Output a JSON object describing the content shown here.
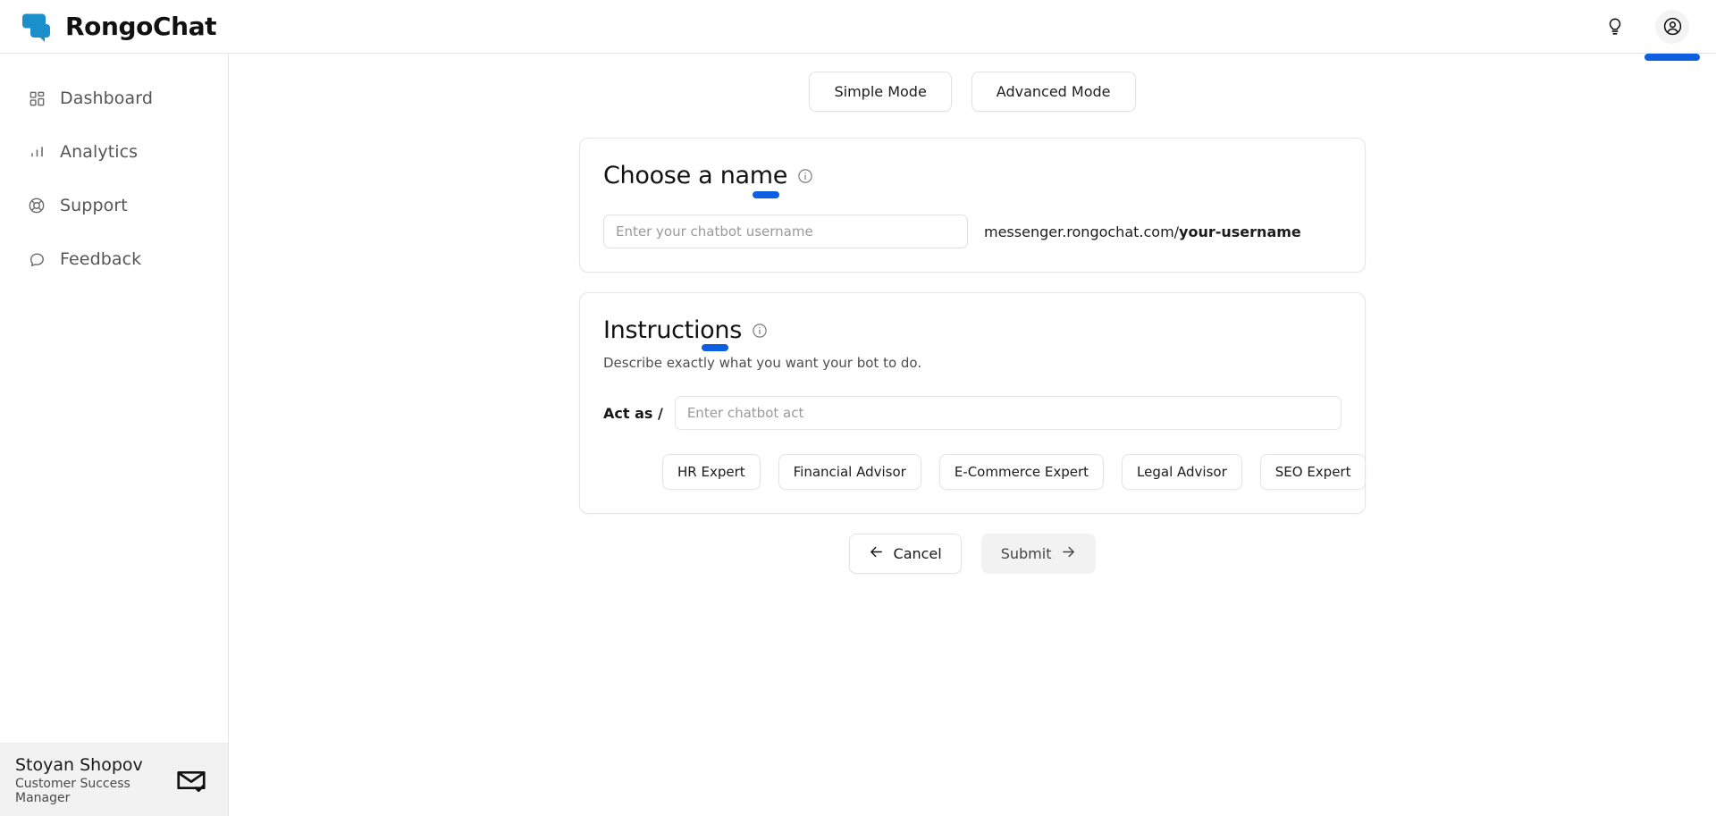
{
  "brand": {
    "name": "RongoChat",
    "logo_icon": "chat-bubbles-icon",
    "logo_color": "#1a8fcb"
  },
  "header": {
    "hint_icon": "lightbulb-icon",
    "account_icon": "user-circle-icon",
    "accent_color": "#0b5fe0"
  },
  "sidebar": {
    "items": [
      {
        "label": "Dashboard",
        "icon": "grid-icon"
      },
      {
        "label": "Analytics",
        "icon": "bar-chart-icon"
      },
      {
        "label": "Support",
        "icon": "lifebuoy-icon"
      },
      {
        "label": "Feedback",
        "icon": "chat-bubble-icon"
      }
    ],
    "profile": {
      "name": "Stoyan Shopov",
      "role": "Customer Success Manager",
      "mail_icon": "envelope-check-icon"
    }
  },
  "main": {
    "modes": [
      {
        "label": "Simple Mode",
        "selected": false
      },
      {
        "label": "Advanced Mode",
        "selected": false
      }
    ],
    "name_card": {
      "title": "Choose a name",
      "info_icon": "info-circle-icon",
      "input_placeholder": "Enter your chatbot username",
      "input_value": "",
      "url_prefix": "messenger.rongochat.com/",
      "url_suffix": "your-username"
    },
    "instructions_card": {
      "title": "Instructions",
      "info_icon": "info-circle-icon",
      "subtitle": "Describe exactly what you want your bot to do.",
      "act_as_label": "Act as /",
      "act_as_placeholder": "Enter chatbot act",
      "act_as_value": "",
      "presets": [
        "HR Expert",
        "Financial Advisor",
        "E-Commerce Expert",
        "Legal Advisor",
        "SEO Expert"
      ]
    },
    "actions": {
      "cancel_label": "Cancel",
      "cancel_icon": "arrow-left-icon",
      "submit_label": "Submit",
      "submit_icon": "arrow-right-icon"
    }
  }
}
